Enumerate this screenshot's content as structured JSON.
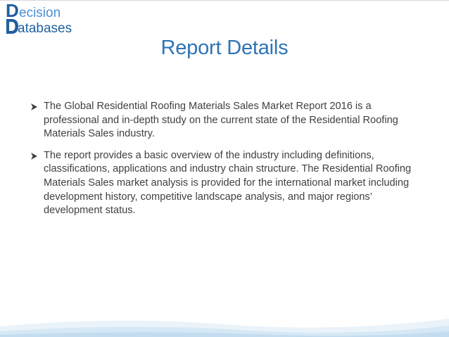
{
  "logo": {
    "line1_initial": "D",
    "line1_text": "ecision",
    "line2_text": "atabases",
    "colors": {
      "primary": "#1f5f9f",
      "accent": "#4a8fd0"
    }
  },
  "title": "Report Details",
  "bullets": [
    {
      "text": "The Global Residential Roofing Materials Sales Market Report 2016 is a professional and in-depth study on the current state of the Residential Roofing Materials Sales  industry."
    },
    {
      "text": "The report provides a basic overview of the industry including definitions, classifications, applications and industry chain structure. The Residential Roofing Materials Sales  market analysis is provided for the international market including development history, competitive landscape analysis, and major regions’ development status."
    }
  ],
  "icons": {
    "bullet_marker": "arrowhead-bullet-icon"
  },
  "theme": {
    "title_color": "#2e74b5",
    "body_color": "#404040",
    "wave_color": "#cfe3f3"
  }
}
